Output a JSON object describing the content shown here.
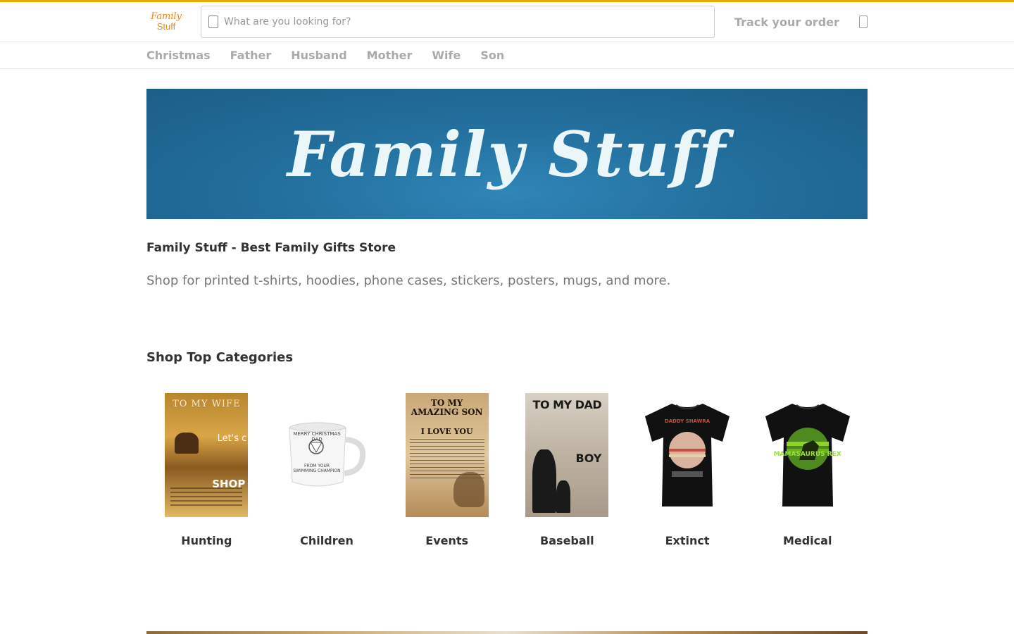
{
  "header": {
    "logo_line1": "Family",
    "logo_line2": "Stuff",
    "search_placeholder": "What are you looking for?",
    "track_label": "Track your order"
  },
  "nav": {
    "items": [
      "Christmas",
      "Father",
      "Husband",
      "Mother",
      "Wife",
      "Son"
    ]
  },
  "banner": {
    "text": "Family Stuff"
  },
  "intro": {
    "title": "Family Stuff - Best Family Gifts Store",
    "subtitle": "Shop for printed t-shirts, hoodies, phone cases, stickers, posters, mugs, and more."
  },
  "categories": {
    "title": "Shop Top Categories",
    "items": [
      {
        "label": "Hunting",
        "image_text": "TO MY WIFE",
        "image_text2": "Let's c",
        "image_text3": "SHOP"
      },
      {
        "label": "Children",
        "image_text": "MERRY CHRISTMAS DAD",
        "image_text2": "FROM YOUR SWIMMING CHAMPION"
      },
      {
        "label": "Events",
        "image_text": "TO MY AMAZING SON",
        "image_text2": "I LOVE YOU"
      },
      {
        "label": "Baseball",
        "image_text": "TO MY DAD",
        "image_text2": "BOY"
      },
      {
        "label": "Extinct",
        "image_text": "DADDY SHAWRA"
      },
      {
        "label": "Medical",
        "image_text": "MAMASAURUS REX"
      }
    ]
  },
  "colors": {
    "accent": "#f0a800",
    "banner": "#236f9d",
    "logo": "#e8891e"
  }
}
